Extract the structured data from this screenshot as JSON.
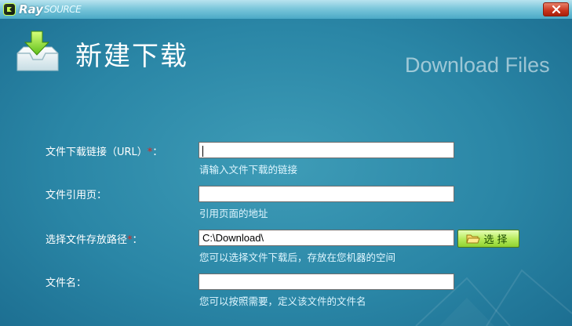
{
  "window": {
    "logo_primary": "Ray",
    "logo_secondary": "SOURCE",
    "close_glyph": "✕"
  },
  "header": {
    "title": "新建下载",
    "subtitle": "Download Files",
    "icon": "download-tray-icon"
  },
  "form": {
    "url": {
      "label": "文件下载链接（URL）",
      "required": true,
      "required_mark": "*",
      "colon": "：",
      "value": "",
      "hint": "请输入文件下载的链接"
    },
    "referer": {
      "label": "文件引用页：",
      "value": "",
      "hint": "引用页面的地址"
    },
    "save_path": {
      "label": "选择文件存放路径",
      "required": true,
      "required_mark": "*",
      "colon": "：",
      "value": "C:\\Download\\",
      "hint": "您可以选择文件下载后，存放在您机器的空间",
      "browse_button": "选择",
      "browse_icon": "folder-open-icon"
    },
    "filename": {
      "label": "文件名：",
      "value": "",
      "hint": "您可以按照需要，定义该文件的文件名"
    }
  },
  "colors": {
    "background": "#2a86a6",
    "title_bar": "#7cc7db",
    "required_mark": "#e0231b",
    "close_button": "#c9331b",
    "browse_button": "#b9ec5f"
  }
}
